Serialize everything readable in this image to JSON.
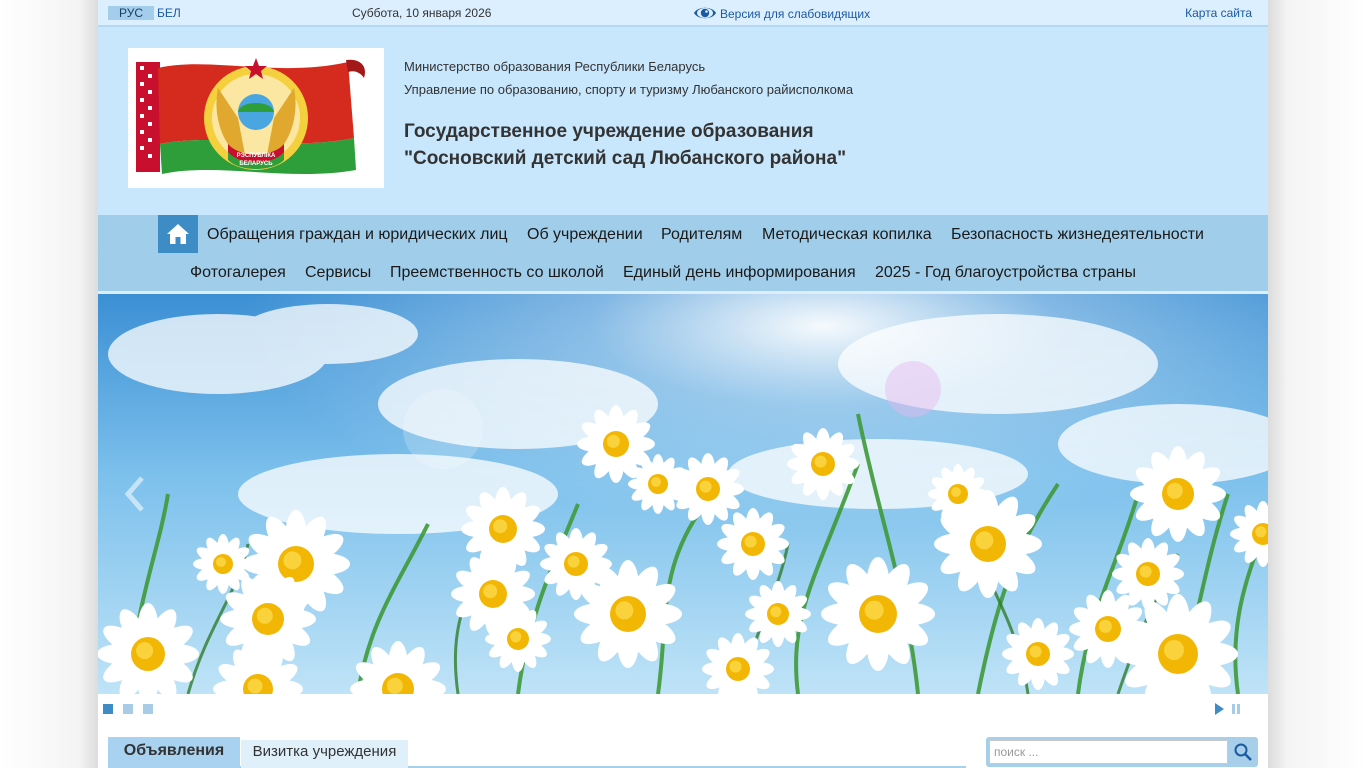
{
  "topbar": {
    "lang_ru": "РУС",
    "lang_be": "БЕЛ",
    "date": "Суббота, 10 января 2026",
    "low_vision": "Версия для слабовидящих",
    "sitemap": "Карта сайта"
  },
  "header": {
    "ministry": "Министерство образования Республики Беларусь",
    "department": "Управление по образованию, спорту и туризму Любанского райисполкома",
    "org_line1": "Государственное учреждение образования",
    "org_line2": "\"Сосновский детский сад Любанского района\"",
    "emblem_text_1": "РЭСПУБЛІКА",
    "emblem_text_2": "БЕЛАРУСЬ"
  },
  "nav": {
    "home_icon": "home-icon",
    "row1": [
      "Обращения граждан и юридических лиц",
      "Об учреждении",
      "Родителям",
      "Методическая копилка",
      "Безопасность жизнедеятельности"
    ],
    "row2": [
      "Фотогалерея",
      "Сервисы",
      "Преемственность со школой",
      "Единый день информирования",
      "2025 - Год благоустройства страны"
    ]
  },
  "slider": {
    "slide_count": 3,
    "active_slide": 1,
    "prev_icon": "chevron-left-icon",
    "play_icon": "play-icon",
    "pause_icon": "pause-icon"
  },
  "tabs": {
    "active": "Объявления",
    "second": "Визитка учреждения"
  },
  "search": {
    "placeholder": "поиск ...",
    "icon": "search-icon"
  },
  "colors": {
    "accent": "#3d8cc6",
    "nav_bg": "#a0cdea",
    "header_bg": "#c8e6fc",
    "topbar_bg": "#dcefff",
    "link": "#1b5aa0"
  }
}
